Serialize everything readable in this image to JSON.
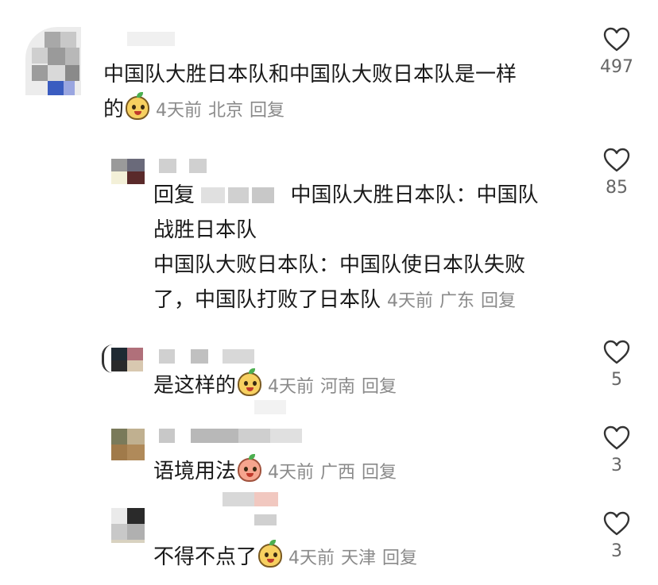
{
  "comments": [
    {
      "text_line1": "中国队大胜日本队和中国队大败日本队是一样",
      "text_line2": "的",
      "time": "4天前",
      "location": "北京",
      "reply": "回复",
      "likes": "497"
    },
    {
      "reply_prefix": "回复",
      "line1": "中国队大胜日本队：中国队",
      "line2": "战胜日本队",
      "line3": "中国队大败日本队：中国队使日本队失败",
      "line4": "了，中国队打败了日本队",
      "time": "4天前",
      "location": "广东",
      "reply": "回复",
      "likes": "85"
    },
    {
      "text": "是这样的",
      "time": "4天前",
      "location": "河南",
      "reply": "回复",
      "likes": "5"
    },
    {
      "text": "语境用法",
      "time": "4天前",
      "location": "广西",
      "reply": "回复",
      "likes": "3"
    },
    {
      "text": "不得不点了",
      "time": "4天前",
      "location": "天津",
      "reply": "回复",
      "likes": "3"
    }
  ],
  "icons": {
    "like": "heart-outline-icon",
    "emoji": "smiling-peach-emoji"
  },
  "colors": {
    "text": "#1a1a1a",
    "meta": "#8a8a8a",
    "count": "#666666"
  }
}
